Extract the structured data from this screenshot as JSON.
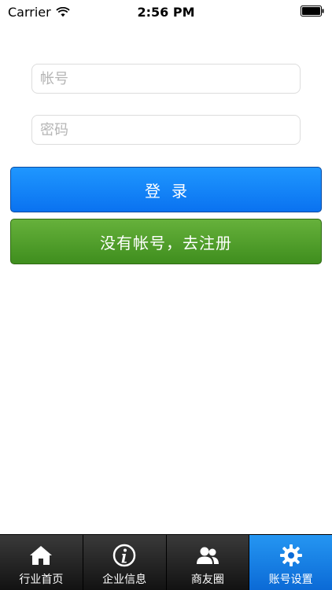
{
  "status_bar": {
    "carrier": "Carrier",
    "time": "2:56 PM"
  },
  "login_form": {
    "account_placeholder": "帐号",
    "password_placeholder": "密码",
    "login_label": "登录",
    "register_label": "没有帐号，去注册"
  },
  "tab_bar": {
    "tabs": [
      {
        "label": "行业首页",
        "icon": "home-icon"
      },
      {
        "label": "企业信息",
        "icon": "info-icon"
      },
      {
        "label": "商友圈",
        "icon": "contacts-icon"
      },
      {
        "label": "账号设置",
        "icon": "gear-icon"
      }
    ],
    "active_index": 3
  },
  "colors": {
    "login_button": "#0a72f0",
    "register_button": "#3f8e1e",
    "tab_active": "#0b6ad6",
    "tab_bar": "#1f1f1f"
  }
}
